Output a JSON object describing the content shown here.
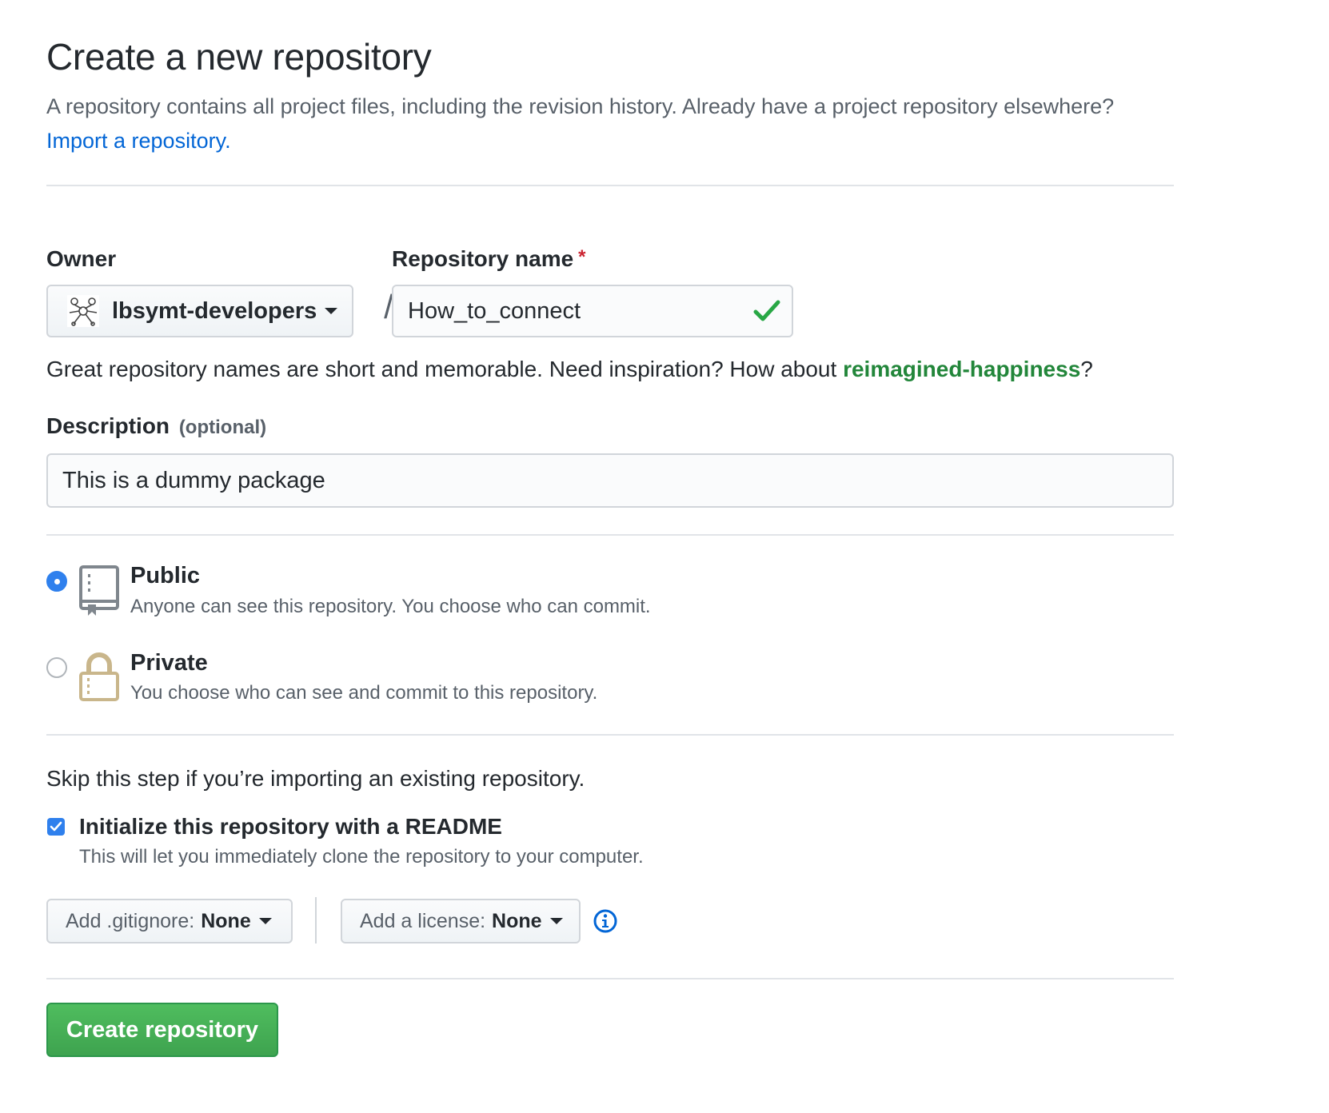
{
  "header": {
    "title": "Create a new repository",
    "subhead_text": "A repository contains all project files, including the revision history. Already have a project repository elsewhere?",
    "import_link": "Import a repository."
  },
  "owner": {
    "label": "Owner",
    "selected": "lbsymt-developers"
  },
  "repo_name": {
    "label": "Repository name",
    "required_mark": "*",
    "value": "How_to_connect",
    "valid": true
  },
  "separator": "/",
  "name_hint": {
    "text": "Great repository names are short and memorable. Need inspiration? How about",
    "suggestion": "reimagined-happiness",
    "end": "?"
  },
  "description": {
    "label": "Description",
    "optional": "(optional)",
    "value": "This is a dummy package"
  },
  "visibility": {
    "public": {
      "title": "Public",
      "desc": "Anyone can see this repository. You choose who can commit.",
      "checked": true
    },
    "private": {
      "title": "Private",
      "desc": "You choose who can see and commit to this repository.",
      "checked": false
    }
  },
  "init": {
    "skip_note": "Skip this step if you’re importing an existing repository.",
    "readme_label": "Initialize this repository with a README",
    "readme_desc": "This will let you immediately clone the repository to your computer.",
    "readme_checked": true
  },
  "gitignore": {
    "prefix": "Add .gitignore:",
    "value": "None"
  },
  "license": {
    "prefix": "Add a license:",
    "value": "None"
  },
  "submit": {
    "label": "Create repository"
  },
  "icons": {
    "public": "repo-book-icon",
    "private": "lock-icon",
    "valid": "check-icon",
    "info": "info-icon"
  },
  "colors": {
    "link": "#0366d6",
    "suggestion": "#22863a",
    "primary_button": "#3ea34f",
    "checked": "#2f80ed",
    "required": "#cb2431"
  }
}
